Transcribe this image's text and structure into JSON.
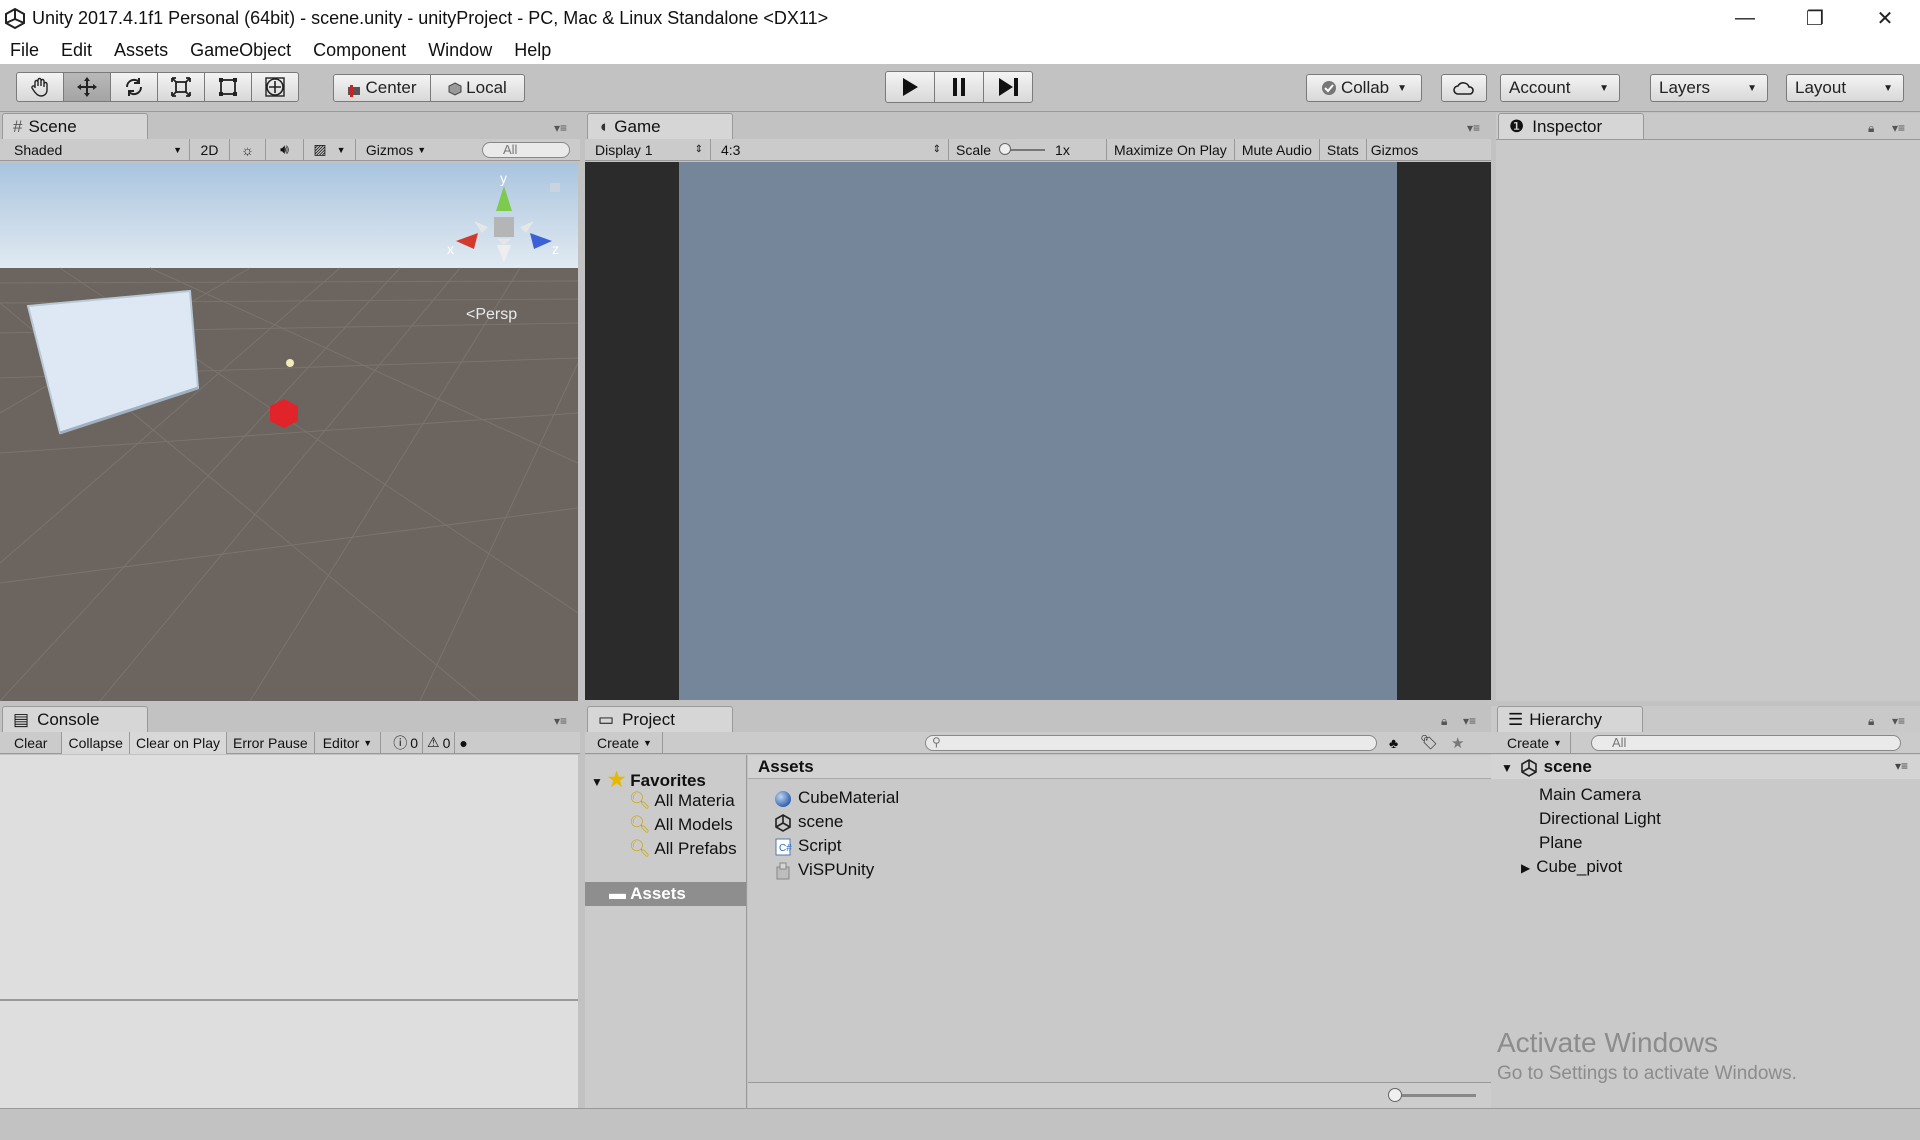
{
  "window": {
    "title": "Unity 2017.4.1f1 Personal (64bit) - scene.unity - unityProject - PC, Mac & Linux Standalone <DX11>",
    "minimize": "—",
    "restore": "❐",
    "close": "✕"
  },
  "menu": [
    "File",
    "Edit",
    "Assets",
    "GameObject",
    "Component",
    "Window",
    "Help"
  ],
  "toolbar": {
    "pivot": "Center",
    "space": "Local",
    "collab": "Collab",
    "account": "Account",
    "layers": "Layers",
    "layout": "Layout"
  },
  "scene": {
    "tab": "Scene",
    "shading": "Shaded",
    "mode2d": "2D",
    "gizmos": "Gizmos",
    "search_placeholder": "All",
    "persp": "Persp",
    "axis_y": "y",
    "axis_x": "x",
    "axis_z": "z"
  },
  "game": {
    "tab": "Game",
    "display": "Display 1",
    "aspect": "4:3",
    "scale_label": "Scale",
    "scale_value": "1x",
    "maximize": "Maximize On Play",
    "mute": "Mute Audio",
    "stats": "Stats",
    "gizmos": "Gizmos"
  },
  "inspector": {
    "tab": "Inspector"
  },
  "console": {
    "tab": "Console",
    "clear": "Clear",
    "collapse": "Collapse",
    "clear_on_play": "Clear on Play",
    "error_pause": "Error Pause",
    "editor": "Editor",
    "info_count": "0",
    "warn_count": "0"
  },
  "project": {
    "tab": "Project",
    "create": "Create",
    "favorites_label": "Favorites",
    "favorites": [
      "All Materia",
      "All Models",
      "All Prefabs"
    ],
    "assets_folder": "Assets",
    "breadcrumb": "Assets",
    "items": [
      {
        "name": "CubeMaterial",
        "icon": "material-icon"
      },
      {
        "name": "scene",
        "icon": "unity-scene-icon"
      },
      {
        "name": "Script",
        "icon": "script-icon"
      },
      {
        "name": "ViSPUnity",
        "icon": "package-icon"
      }
    ]
  },
  "hierarchy": {
    "tab": "Hierarchy",
    "create": "Create",
    "search_placeholder": "All",
    "scene": "scene",
    "items": [
      "Main Camera",
      "Directional Light",
      "Plane",
      "Cube_pivot"
    ]
  },
  "watermark": {
    "line1": "Activate Windows",
    "line2": "Go to Settings to activate Windows."
  },
  "colors": {
    "game_bg": "#75869b",
    "scene_sky": "#b9cfe3",
    "scene_ground": "#6e6660",
    "cube": "#e0242a"
  }
}
